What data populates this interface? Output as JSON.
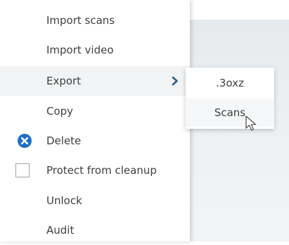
{
  "menu": {
    "items": [
      {
        "label": "Import scans"
      },
      {
        "label": "Import video"
      },
      {
        "label": "Export",
        "has_submenu": true,
        "selected": true
      },
      {
        "label": "Copy"
      },
      {
        "label": "Delete",
        "icon": "delete-icon"
      },
      {
        "label": "Protect from cleanup",
        "control": "checkbox",
        "checked": false
      },
      {
        "label": "Unlock"
      },
      {
        "label": "Audit"
      }
    ]
  },
  "submenu": {
    "items": [
      {
        "label": ".3oxz"
      },
      {
        "label": "Scans",
        "hovered": true
      }
    ]
  },
  "colors": {
    "accent": "#1e6fc3",
    "selected_row": "#f1f3f4",
    "side_background": "#e9ecee"
  }
}
